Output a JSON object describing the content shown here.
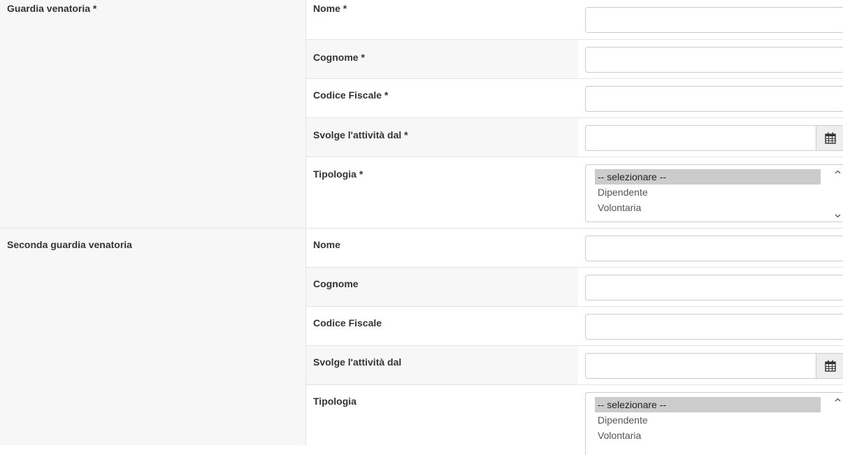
{
  "groups": [
    {
      "label": "Guardia venatoria *",
      "fields": [
        {
          "label": "Nome *"
        },
        {
          "label": "Cognome *"
        },
        {
          "label": "Codice Fiscale *"
        },
        {
          "label": "Svolge l'attività dal *"
        },
        {
          "label": "Tipologia *",
          "options": [
            "-- selezionare --",
            "Dipendente",
            "Volontaria"
          ],
          "selected": "-- selezionare --"
        }
      ]
    },
    {
      "label": "Seconda guardia venatoria",
      "fields": [
        {
          "label": "Nome"
        },
        {
          "label": "Cognome"
        },
        {
          "label": "Codice Fiscale"
        },
        {
          "label": "Svolge l'attività dal"
        },
        {
          "label": "Tipologia",
          "options": [
            "-- selezionare --",
            "Dipendente",
            "Volontaria"
          ],
          "selected": "-- selezionare --"
        }
      ]
    }
  ],
  "icons": {
    "date_picker": "calendar-icon",
    "scroll_up": "chevron-up-icon",
    "scroll_down": "chevron-down-icon"
  },
  "colors": {
    "label_bg": "#f7f7f7",
    "border": "#cccccc",
    "selected_option_bg": "#cccccc",
    "addon_bg": "#eeeeee"
  }
}
